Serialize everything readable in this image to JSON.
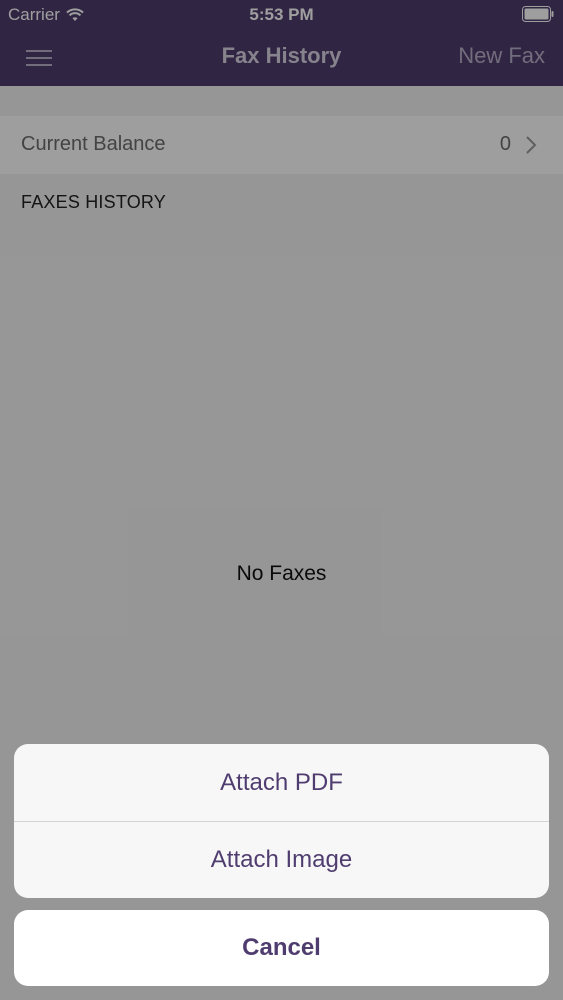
{
  "status_bar": {
    "carrier": "Carrier",
    "time": "5:53 PM",
    "wifi_icon": "wifi-icon",
    "battery_icon": "battery-icon"
  },
  "nav": {
    "menu_icon": "hamburger-menu-icon",
    "title": "Fax History",
    "new_fax_label": "New Fax"
  },
  "balance": {
    "label": "Current Balance",
    "value": "0",
    "chevron_icon": "chevron-right-icon"
  },
  "history": {
    "section_title": "FAXES HISTORY",
    "empty_text": "No Faxes"
  },
  "action_sheet": {
    "options": [
      {
        "label": "Attach PDF"
      },
      {
        "label": "Attach Image"
      }
    ],
    "cancel_label": "Cancel"
  },
  "colors": {
    "brand_purple": "#4f3d6f",
    "overlay": "rgba(0,0,0,0.38)"
  }
}
